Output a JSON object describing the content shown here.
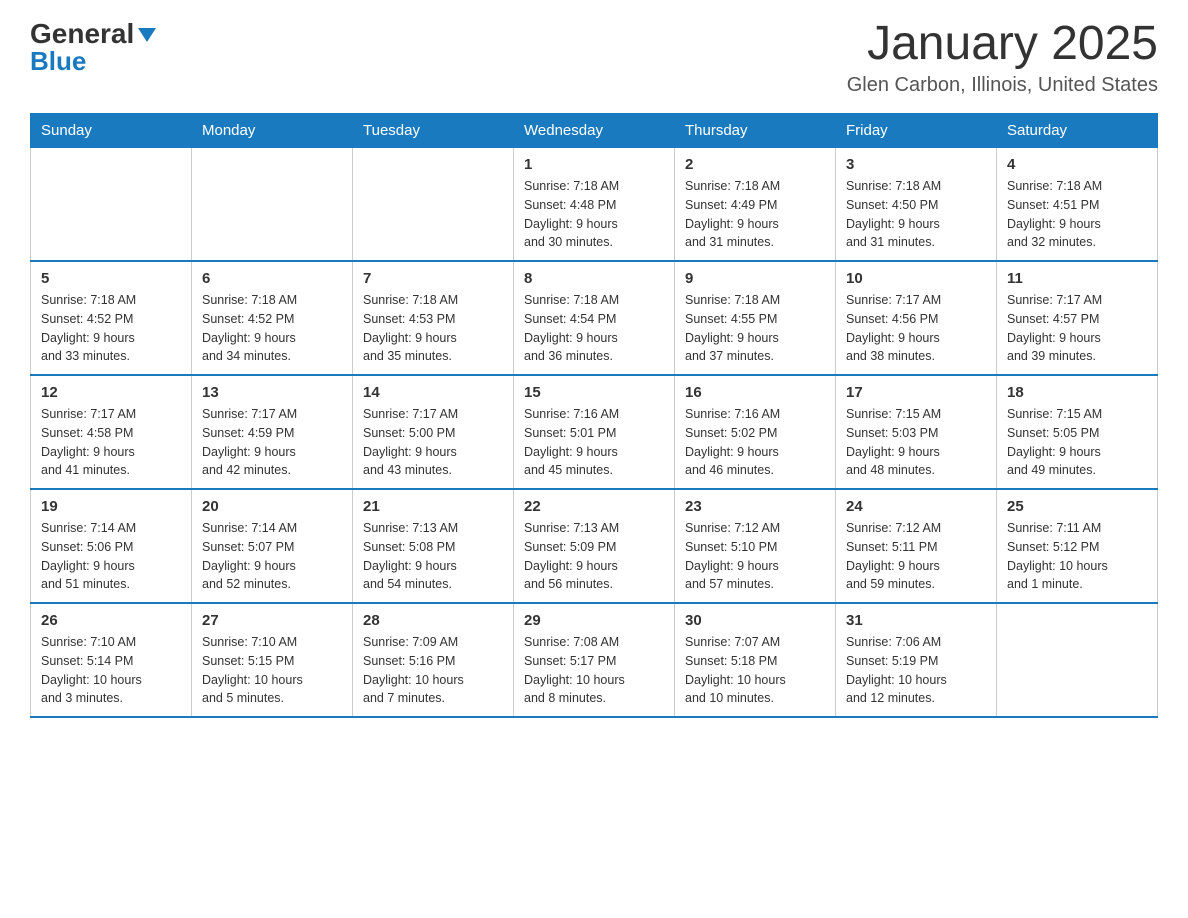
{
  "header": {
    "logo_line1": "General",
    "logo_line2": "Blue",
    "title": "January 2025",
    "subtitle": "Glen Carbon, Illinois, United States"
  },
  "days_of_week": [
    "Sunday",
    "Monday",
    "Tuesday",
    "Wednesday",
    "Thursday",
    "Friday",
    "Saturday"
  ],
  "weeks": [
    [
      {
        "day": "",
        "info": ""
      },
      {
        "day": "",
        "info": ""
      },
      {
        "day": "",
        "info": ""
      },
      {
        "day": "1",
        "info": "Sunrise: 7:18 AM\nSunset: 4:48 PM\nDaylight: 9 hours\nand 30 minutes."
      },
      {
        "day": "2",
        "info": "Sunrise: 7:18 AM\nSunset: 4:49 PM\nDaylight: 9 hours\nand 31 minutes."
      },
      {
        "day": "3",
        "info": "Sunrise: 7:18 AM\nSunset: 4:50 PM\nDaylight: 9 hours\nand 31 minutes."
      },
      {
        "day": "4",
        "info": "Sunrise: 7:18 AM\nSunset: 4:51 PM\nDaylight: 9 hours\nand 32 minutes."
      }
    ],
    [
      {
        "day": "5",
        "info": "Sunrise: 7:18 AM\nSunset: 4:52 PM\nDaylight: 9 hours\nand 33 minutes."
      },
      {
        "day": "6",
        "info": "Sunrise: 7:18 AM\nSunset: 4:52 PM\nDaylight: 9 hours\nand 34 minutes."
      },
      {
        "day": "7",
        "info": "Sunrise: 7:18 AM\nSunset: 4:53 PM\nDaylight: 9 hours\nand 35 minutes."
      },
      {
        "day": "8",
        "info": "Sunrise: 7:18 AM\nSunset: 4:54 PM\nDaylight: 9 hours\nand 36 minutes."
      },
      {
        "day": "9",
        "info": "Sunrise: 7:18 AM\nSunset: 4:55 PM\nDaylight: 9 hours\nand 37 minutes."
      },
      {
        "day": "10",
        "info": "Sunrise: 7:17 AM\nSunset: 4:56 PM\nDaylight: 9 hours\nand 38 minutes."
      },
      {
        "day": "11",
        "info": "Sunrise: 7:17 AM\nSunset: 4:57 PM\nDaylight: 9 hours\nand 39 minutes."
      }
    ],
    [
      {
        "day": "12",
        "info": "Sunrise: 7:17 AM\nSunset: 4:58 PM\nDaylight: 9 hours\nand 41 minutes."
      },
      {
        "day": "13",
        "info": "Sunrise: 7:17 AM\nSunset: 4:59 PM\nDaylight: 9 hours\nand 42 minutes."
      },
      {
        "day": "14",
        "info": "Sunrise: 7:17 AM\nSunset: 5:00 PM\nDaylight: 9 hours\nand 43 minutes."
      },
      {
        "day": "15",
        "info": "Sunrise: 7:16 AM\nSunset: 5:01 PM\nDaylight: 9 hours\nand 45 minutes."
      },
      {
        "day": "16",
        "info": "Sunrise: 7:16 AM\nSunset: 5:02 PM\nDaylight: 9 hours\nand 46 minutes."
      },
      {
        "day": "17",
        "info": "Sunrise: 7:15 AM\nSunset: 5:03 PM\nDaylight: 9 hours\nand 48 minutes."
      },
      {
        "day": "18",
        "info": "Sunrise: 7:15 AM\nSunset: 5:05 PM\nDaylight: 9 hours\nand 49 minutes."
      }
    ],
    [
      {
        "day": "19",
        "info": "Sunrise: 7:14 AM\nSunset: 5:06 PM\nDaylight: 9 hours\nand 51 minutes."
      },
      {
        "day": "20",
        "info": "Sunrise: 7:14 AM\nSunset: 5:07 PM\nDaylight: 9 hours\nand 52 minutes."
      },
      {
        "day": "21",
        "info": "Sunrise: 7:13 AM\nSunset: 5:08 PM\nDaylight: 9 hours\nand 54 minutes."
      },
      {
        "day": "22",
        "info": "Sunrise: 7:13 AM\nSunset: 5:09 PM\nDaylight: 9 hours\nand 56 minutes."
      },
      {
        "day": "23",
        "info": "Sunrise: 7:12 AM\nSunset: 5:10 PM\nDaylight: 9 hours\nand 57 minutes."
      },
      {
        "day": "24",
        "info": "Sunrise: 7:12 AM\nSunset: 5:11 PM\nDaylight: 9 hours\nand 59 minutes."
      },
      {
        "day": "25",
        "info": "Sunrise: 7:11 AM\nSunset: 5:12 PM\nDaylight: 10 hours\nand 1 minute."
      }
    ],
    [
      {
        "day": "26",
        "info": "Sunrise: 7:10 AM\nSunset: 5:14 PM\nDaylight: 10 hours\nand 3 minutes."
      },
      {
        "day": "27",
        "info": "Sunrise: 7:10 AM\nSunset: 5:15 PM\nDaylight: 10 hours\nand 5 minutes."
      },
      {
        "day": "28",
        "info": "Sunrise: 7:09 AM\nSunset: 5:16 PM\nDaylight: 10 hours\nand 7 minutes."
      },
      {
        "day": "29",
        "info": "Sunrise: 7:08 AM\nSunset: 5:17 PM\nDaylight: 10 hours\nand 8 minutes."
      },
      {
        "day": "30",
        "info": "Sunrise: 7:07 AM\nSunset: 5:18 PM\nDaylight: 10 hours\nand 10 minutes."
      },
      {
        "day": "31",
        "info": "Sunrise: 7:06 AM\nSunset: 5:19 PM\nDaylight: 10 hours\nand 12 minutes."
      },
      {
        "day": "",
        "info": ""
      }
    ]
  ]
}
